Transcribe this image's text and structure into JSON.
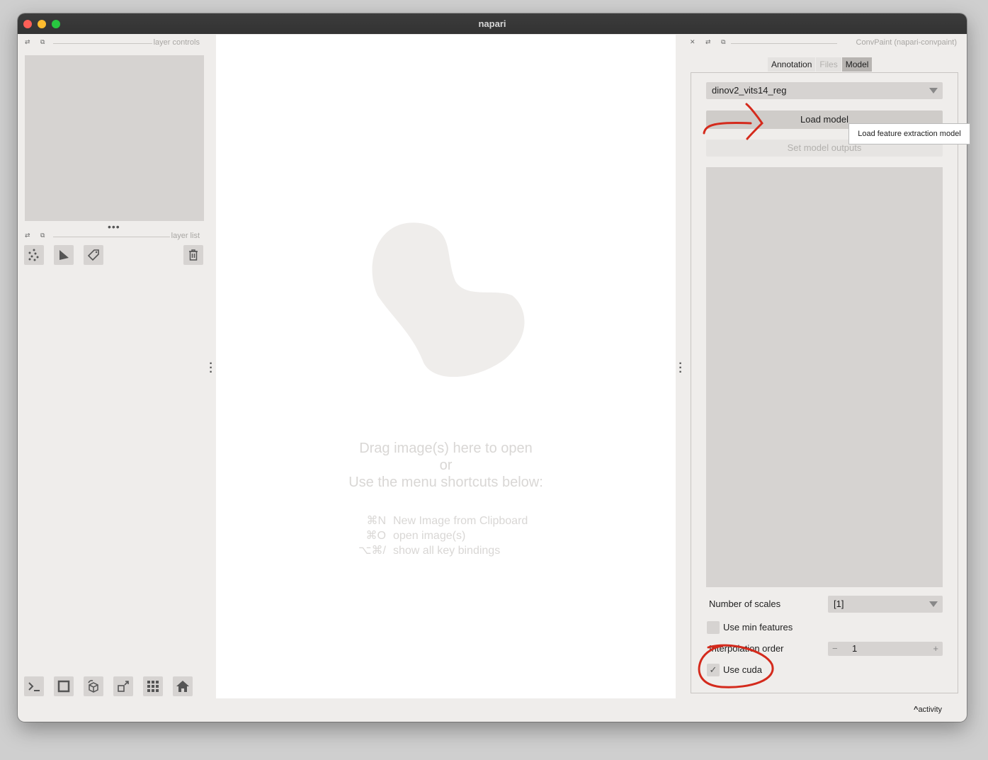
{
  "window": {
    "title": "napari"
  },
  "left_dock": {
    "layer_controls_title": "layer controls",
    "layer_list_title": "layer list",
    "dock_buttons": "⇄ ⧉",
    "resize_handle": "•••"
  },
  "canvas": {
    "welcome_line1": "Drag image(s) here to open",
    "welcome_line2": "or",
    "welcome_line3": "Use the menu shortcuts below:",
    "shortcuts": [
      {
        "keys": "⌘N",
        "label": "New Image from Clipboard"
      },
      {
        "keys": "⌘O",
        "label": "open image(s)"
      },
      {
        "keys": "⌥⌘/",
        "label": "show all key bindings"
      }
    ]
  },
  "right_dock": {
    "title": "ConvPaint (napari-convpaint)",
    "dock_buttons": "✕ ⇄ ⧉",
    "tabs": [
      {
        "label": "Annotation"
      },
      {
        "label": "Files"
      },
      {
        "label": "Model"
      }
    ],
    "model_select": {
      "value": "dinov2_vits14_reg"
    },
    "load_model_label": "Load model",
    "set_outputs_label": "Set model outputs",
    "tooltip": "Load feature extraction model",
    "num_scales_label": "Number of scales",
    "num_scales_value": "[1]",
    "min_features_label": "Use min features",
    "interp_order_label": "Interpolation order",
    "interp_order_value": "1",
    "use_cuda_label": "Use cuda",
    "checkmark": "✓"
  },
  "status": {
    "activity_label": "activity",
    "activity_caret": "^"
  },
  "colors": {
    "annotation_red": "#d42a1c"
  }
}
